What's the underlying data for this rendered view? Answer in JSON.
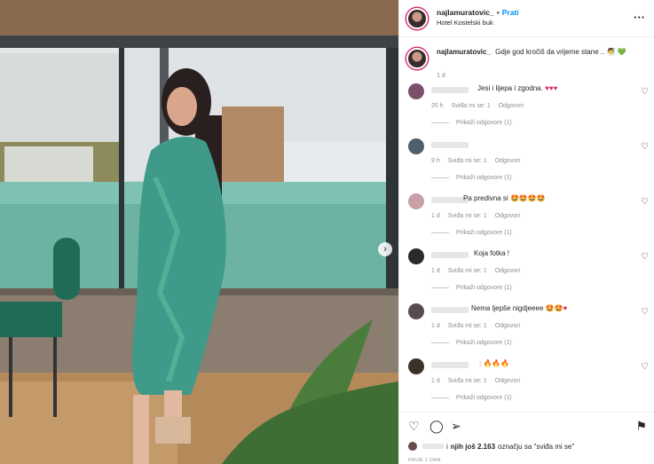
{
  "post": {
    "username": "najlamuratovic_",
    "separator": "•",
    "follow_label": "Prati",
    "location": "Hotel Kostelski buk",
    "more_icon": "more-options-icon",
    "caption_text": "Gdje god kročiš da vrijeme stane ..",
    "caption_emoji_1": "🧖",
    "caption_emoji_2": "💚",
    "caption_time": "1 d",
    "next_arrow": "›"
  },
  "comments": [
    {
      "text": "Jesi i lijepa i zgodna.",
      "emoji": "♥♥♥",
      "time": "20 h",
      "likes": "Sviđa mi se: 1",
      "reply": "Odgovori",
      "replies": "Prikaži odgovore (1)",
      "avatar_color": "#7b4f6b",
      "text_left": 88
    },
    {
      "text": "",
      "emoji": "",
      "time": "9 h",
      "likes": "Sviđa mi se: 1",
      "reply": "Odgovori",
      "replies": "Prikaži odgovore (1)",
      "avatar_color": "#4d5e6e",
      "text_left": 88
    },
    {
      "text": "Pa predivna si",
      "emoji": "🤩🤩🤩🤩",
      "time": "1 d",
      "likes": "Sviđa mi se: 1",
      "reply": "Odgovori",
      "replies": "Prikaži odgovore (1)",
      "avatar_color": "#c9a0a8",
      "text_left": 72
    },
    {
      "text": "Koja fotka !",
      "emoji": "",
      "time": "1 d",
      "likes": "Sviđa mi se: 1",
      "reply": "Odgovori",
      "replies": "Prikaži odgovore (1)",
      "avatar_color": "#2b2b2b",
      "text_left": 84
    },
    {
      "text": "Nema ljepše nigdjeeee",
      "emoji": "🤩🤩♥",
      "time": "1 d",
      "likes": "Sviđa mi se: 1",
      "reply": "Odgovori",
      "replies": "Prikaži odgovore (1)",
      "avatar_color": "#5a4a52",
      "text_left": 81
    },
    {
      "text": ":",
      "emoji": "🔥🔥🔥",
      "time": "1 d",
      "likes": "Sviđa mi se: 1",
      "reply": "Odgovori",
      "replies": "Prikaži odgovore (1)",
      "avatar_color": "#3a3226",
      "text_left": 90
    }
  ],
  "actions": {
    "like_icon": "heart-icon",
    "comment_icon": "comment-icon",
    "share_icon": "share-icon",
    "save_icon": "bookmark-icon"
  },
  "likes_summary": {
    "prefix": "i",
    "others": "njih još 2.163",
    "suffix": "označju sa \"sviđa mi se\""
  },
  "post_date": "PRIJE 1 DAN"
}
